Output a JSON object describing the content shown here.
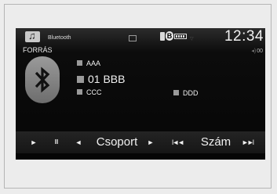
{
  "status_bar": {
    "source_name": "Bluetooth",
    "bt_badge": "B",
    "clock": "12:34"
  },
  "header": {
    "source_label": "FORRÁS",
    "volume": "00"
  },
  "track": {
    "artist": "AAA",
    "title": "01 BBB",
    "album": "CCC",
    "genre": "DDD"
  },
  "controls": {
    "play_glyph": "►",
    "pause_glyph": "II",
    "group_prev_glyph": "◄",
    "group_label": "Csoport",
    "group_next_glyph": "►",
    "track_prev_glyph": "I◄◄",
    "track_label": "Szám",
    "track_next_glyph": "►►I"
  },
  "icons": {
    "source": "music-note-icon",
    "message": "message-icon",
    "phone": "phone-icon",
    "bluetooth": "bluetooth-icon",
    "battery": "battery-icon",
    "signal": "signal-icon",
    "volume": "speaker-icon"
  }
}
